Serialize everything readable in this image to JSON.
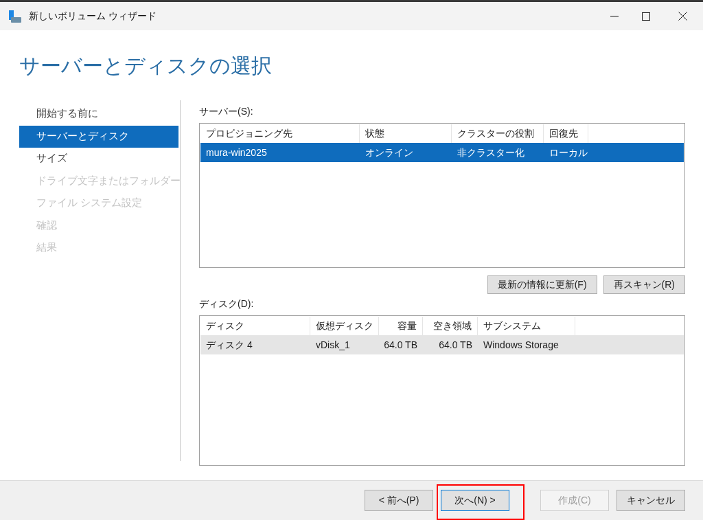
{
  "window": {
    "title": "新しいボリューム ウィザード"
  },
  "heading": "サーバーとディスクの選択",
  "steps": [
    {
      "label": "開始する前に",
      "selected": false,
      "disabled": false
    },
    {
      "label": "サーバーとディスク",
      "selected": true,
      "disabled": false
    },
    {
      "label": "サイズ",
      "selected": false,
      "disabled": false
    },
    {
      "label": "ドライブ文字またはフォルダー",
      "selected": false,
      "disabled": true
    },
    {
      "label": "ファイル システム設定",
      "selected": false,
      "disabled": true
    },
    {
      "label": "確認",
      "selected": false,
      "disabled": true
    },
    {
      "label": "結果",
      "selected": false,
      "disabled": true
    }
  ],
  "server_list": {
    "label": "サーバー(S):",
    "focused": true,
    "columns": [
      "プロビジョニング先",
      "状態",
      "クラスターの役割",
      "回復先"
    ],
    "rows": [
      {
        "cells": [
          "mura-win2025",
          "オンライン",
          "非クラスター化",
          "ローカル"
        ],
        "selected": true
      }
    ]
  },
  "list_buttons": [
    "最新の情報に更新(F)",
    "再スキャン(R)"
  ],
  "disk_list": {
    "label": "ディスク(D):",
    "focused": false,
    "columns": [
      "ディスク",
      "仮想ディスク",
      "容量",
      "空き領域",
      "サブシステム"
    ],
    "rows": [
      {
        "cells": [
          "ディスク 4",
          "vDisk_1",
          "64.0 TB",
          "64.0 TB",
          "Windows Storage"
        ],
        "selected": true
      }
    ]
  },
  "footer_buttons": [
    {
      "label": "< 前へ(P)",
      "disabled": false,
      "focused": false,
      "highlighted": false
    },
    {
      "label": "次へ(N) >",
      "disabled": false,
      "focused": true,
      "highlighted": true
    },
    {
      "label": "作成(C)",
      "disabled": true,
      "focused": false,
      "highlighted": false
    },
    {
      "label": "キャンセル",
      "disabled": false,
      "focused": false,
      "highlighted": false
    }
  ]
}
